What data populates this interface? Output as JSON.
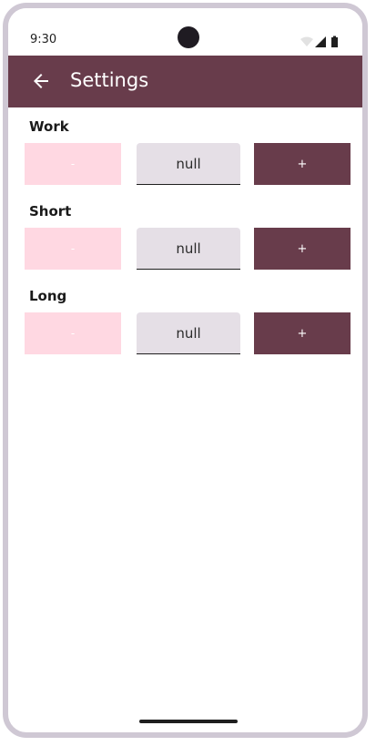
{
  "status_bar": {
    "time": "9:30"
  },
  "app_bar": {
    "title": "Settings",
    "back_icon": "arrow-back-icon"
  },
  "sections": [
    {
      "label": "Work",
      "minus_label": "-",
      "value": "null",
      "plus_label": "+"
    },
    {
      "label": "Short",
      "minus_label": "-",
      "value": "null",
      "plus_label": "+"
    },
    {
      "label": "Long",
      "minus_label": "-",
      "value": "null",
      "plus_label": "+"
    }
  ],
  "colors": {
    "primary": "#683c4b",
    "minus_button": "#ffd8e2",
    "field_background": "#e5dfe6",
    "frame": "#cfc8d4"
  }
}
